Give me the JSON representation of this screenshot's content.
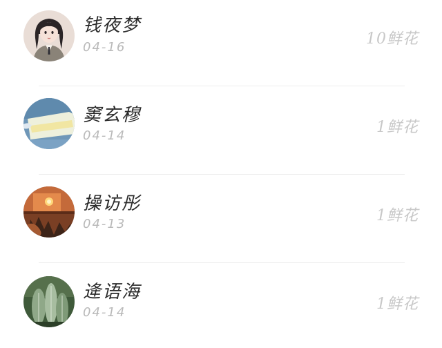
{
  "gift_list": {
    "items": [
      {
        "name": "钱夜梦",
        "date": "04-16",
        "flowers": "10鲜花",
        "avatar_icon": "girl-portrait-avatar"
      },
      {
        "name": "窦玄穆",
        "date": "04-14",
        "flowers": "1鲜花",
        "avatar_icon": "blue-abstract-avatar"
      },
      {
        "name": "操访彤",
        "date": "04-13",
        "flowers": "1鲜花",
        "avatar_icon": "sunset-window-avatar"
      },
      {
        "name": "逄语海",
        "date": "04-14",
        "flowers": "1鲜花",
        "avatar_icon": "cactus-avatar"
      }
    ]
  },
  "colors": {
    "name_text": "#2b2b2b",
    "date_text": "#b9b9b9",
    "flowers_text": "#c8c8c8",
    "divider": "#ededed"
  }
}
